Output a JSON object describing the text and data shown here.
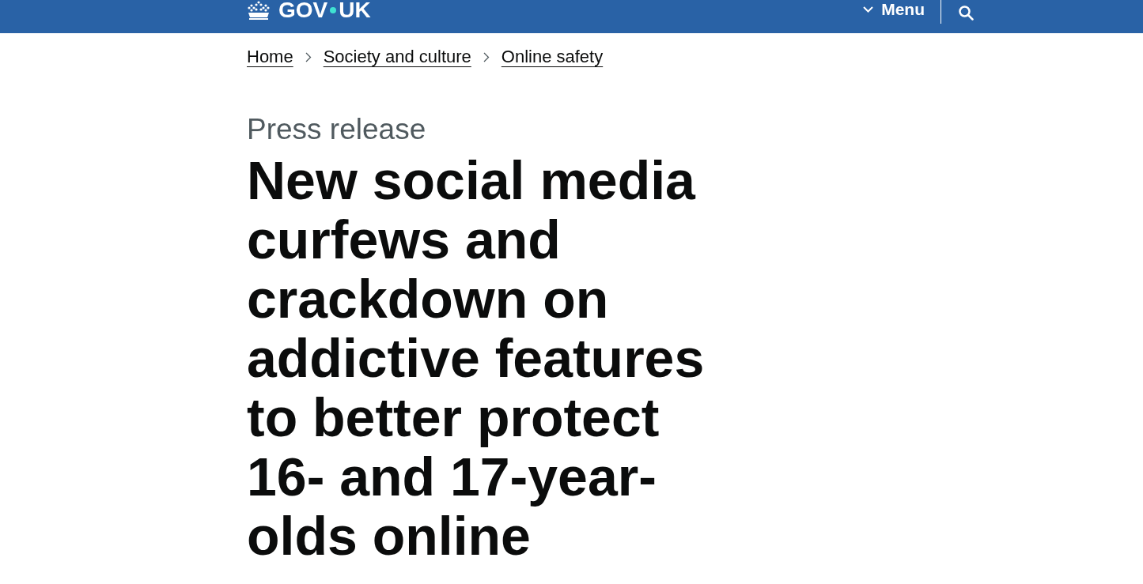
{
  "header": {
    "logo": {
      "parts": [
        "GOV",
        "UK"
      ]
    },
    "menu_button": {
      "label": "Menu",
      "expanded": false
    }
  },
  "breadcrumbs": [
    "Home",
    "Society and culture",
    "Online safety"
  ],
  "caption": "Press release",
  "title": "New social media curfews and crackdown on addictive features to better protect 16- and 17-year-olds online"
}
